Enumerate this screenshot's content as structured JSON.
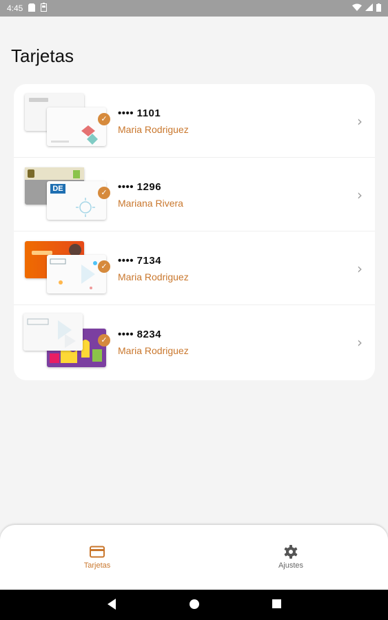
{
  "status_bar": {
    "time": "4:45",
    "left_icons": [
      "sd-card-icon",
      "battery-saver-icon"
    ],
    "right_icons": [
      "wifi-icon",
      "signal-icon",
      "battery-icon"
    ]
  },
  "page": {
    "title": "Tarjetas"
  },
  "cards": [
    {
      "number": "•••• 1101",
      "holder": "Maria Rodriguez",
      "selected": true
    },
    {
      "number": "•••• 1296",
      "holder": "Mariana Rivera",
      "selected": true
    },
    {
      "number": "•••• 7134",
      "holder": "Maria Rodriguez",
      "selected": true
    },
    {
      "number": "•••• 8234",
      "holder": "Maria Rodriguez",
      "selected": true
    }
  ],
  "bottom_nav": {
    "items": [
      {
        "label": "Tarjetas",
        "icon": "credit-card-icon",
        "active": true
      },
      {
        "label": "Ajustes",
        "icon": "gear-icon",
        "active": false
      }
    ]
  },
  "colors": {
    "accent": "#c9772d",
    "check": "#d68a3c",
    "background": "#f4f4f4",
    "status_bar": "#9e9e9e"
  }
}
